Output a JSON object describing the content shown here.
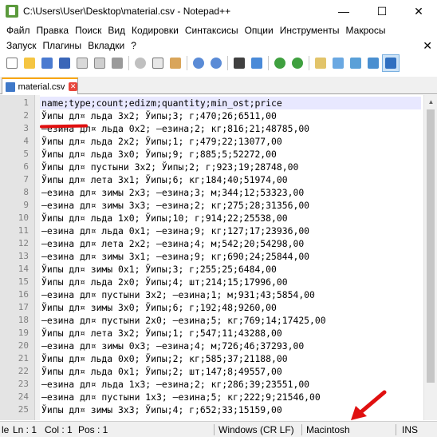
{
  "window": {
    "title": "C:\\Users\\User\\Desktop\\material.csv - Notepad++",
    "minimize_glyph": "—",
    "maximize_glyph": "☐",
    "close_glyph": "✕"
  },
  "menu": {
    "items": [
      "Файл",
      "Правка",
      "Поиск",
      "Вид",
      "Кодировки",
      "Синтаксисы",
      "Опции",
      "Инструменты",
      "Макросы",
      "Запуск",
      "Плагины",
      "Вкладки",
      "?"
    ],
    "close_glyph": "✕"
  },
  "toolbar": {
    "icons": [
      "new-file-icon",
      "open-file-icon",
      "save-icon",
      "save-all-icon",
      "close-icon",
      "close-all-icon",
      "print-icon",
      "cut-icon",
      "copy-icon",
      "paste-icon",
      "undo-icon",
      "redo-icon",
      "find-icon",
      "replace-icon",
      "zoom-in-icon",
      "zoom-out-icon",
      "sync-v-icon",
      "sync-h-icon",
      "word-wrap-icon",
      "show-all-chars-icon",
      "indent-guide-icon"
    ]
  },
  "tab": {
    "label": "material.csv",
    "close_glyph": "✕"
  },
  "editor": {
    "lines": [
      "name;type;count;edizm;quantity;min_ost;price",
      "Ўипы дл¤ льда 3х2; Ўипы;3; г;470;26;6511,00",
      "–езина дл¤ льда 0х2; –езина;2; кг;816;21;48785,00",
      "Ўипы дл¤ льда 2х2; Ўипы;1; г;479;22;13077,00",
      "Ўипы дл¤ льда 3х0; Ўипы;9; г;885;5;52272,00",
      "Ўипы дл¤ пустыни 3х2; Ўипы;2; г;923;19;28748,00",
      "Ўипы дл¤ лета 3х1; Ўипы;6; кг;184;40;51974,00",
      "–езина дл¤ зимы 2х3; –езина;3; м;344;12;53323,00",
      "–езина дл¤ зимы 3х3; –езина;2; кг;275;28;31356,00",
      "Ўипы дл¤ льда 1х0; Ўипы;10; г;914;22;25538,00",
      "–езина дл¤ льда 0х1; –езина;9; кг;127;17;23936,00",
      "–езина дл¤ лета 2х2; –езина;4; м;542;20;54298,00",
      "–езина дл¤ зимы 3х1; –езина;9; кг;690;24;25844,00",
      "Ўипы дл¤ зимы 0х1; Ўипы;3; г;255;25;6484,00",
      "Ўипы дл¤ льда 2х0; Ўипы;4; шт;214;15;17996,00",
      "–езина дл¤ пустыни 3х2; –езина;1; м;931;43;5854,00",
      "Ўипы дл¤ зимы 3х0; Ўипы;6; г;192;48;9260,00",
      "–езина дл¤ пустыни 2х0; –езина;5; кг;769;14;17425,00",
      "Ўипы дл¤ лета 3х2; Ўипы;1; г;547;11;43288,00",
      "–езина дл¤ зимы 0х3; –езина;4; м;726;46;37293,00",
      "Ўипы дл¤ льда 0х0; Ўипы;2; кг;585;37;21188,00",
      "Ўипы дл¤ льда 0х1; Ўипы;2; шт;147;8;49557,00",
      "–езина дл¤ льда 1х3; –езина;2; кг;286;39;23551,00",
      "–езина дл¤ пустыни 1х3; –езина;5; кг;222;9;21546,00",
      "Ўипы дл¤ зимы 3х3; Ўипы;4; г;652;33;15159,00"
    ]
  },
  "statusbar": {
    "prefix": "le",
    "ln": "Ln : 1",
    "col": "Col : 1",
    "pos": "Pos : 1",
    "eol": "Windows (CR LF)",
    "encoding": "Macintosh",
    "mode": "INS"
  },
  "colors": {
    "annotation_red": "#e01010",
    "tab_accent": "#f9a602"
  }
}
